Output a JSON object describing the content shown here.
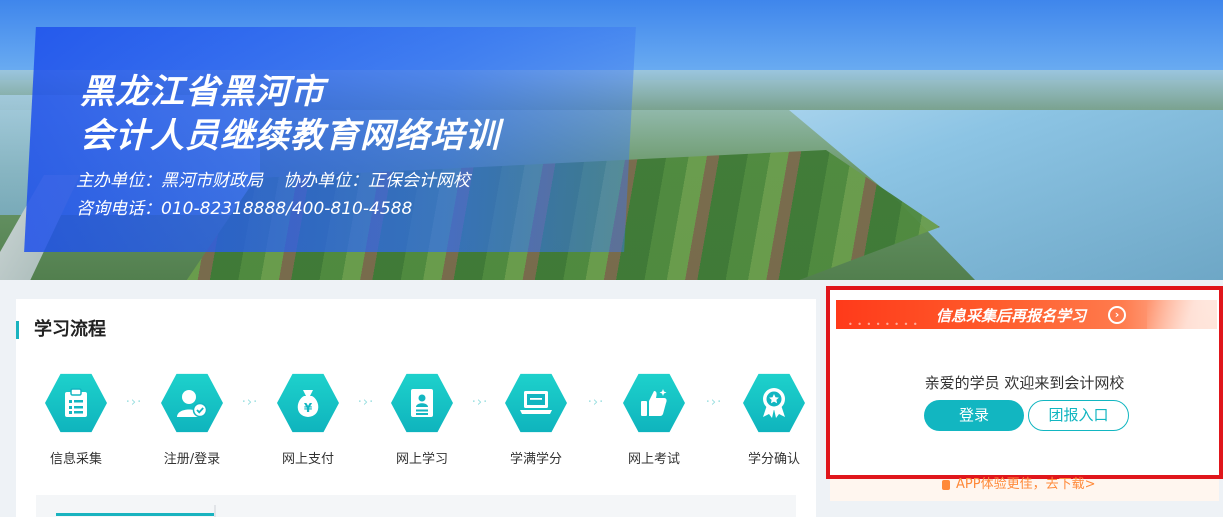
{
  "banner": {
    "title_line1": "黑龙江省黑河市",
    "title_line2": "会计人员继续教育网络培训",
    "host": "主办单位：黑河市财政局",
    "co_host": "协办单位：正保会计网校",
    "phone": "咨询电话：010-82318888/400-810-4588"
  },
  "process": {
    "title": "学习流程",
    "steps": [
      {
        "label": "信息采集",
        "icon": "clipboard-icon"
      },
      {
        "label": "注册/登录",
        "icon": "user-check-icon"
      },
      {
        "label": "网上支付",
        "icon": "money-bag-icon"
      },
      {
        "label": "网上学习",
        "icon": "document-icon"
      },
      {
        "label": "学满学分",
        "icon": "laptop-icon"
      },
      {
        "label": "网上考试",
        "icon": "thumbs-up-icon"
      },
      {
        "label": "学分确认",
        "icon": "award-icon"
      }
    ],
    "separator": "·›·"
  },
  "login_panel": {
    "promo_text": "信息采集后再报名学习",
    "welcome_text": "亲爱的学员 欢迎来到会计网校",
    "login_label": "登录",
    "group_label": "团报入口",
    "app_text": "APP体验更佳，去下载>"
  },
  "colors": {
    "accent": "#12b6c1",
    "highlight_frame": "#e0161b",
    "promo": "#ff3a1a"
  }
}
